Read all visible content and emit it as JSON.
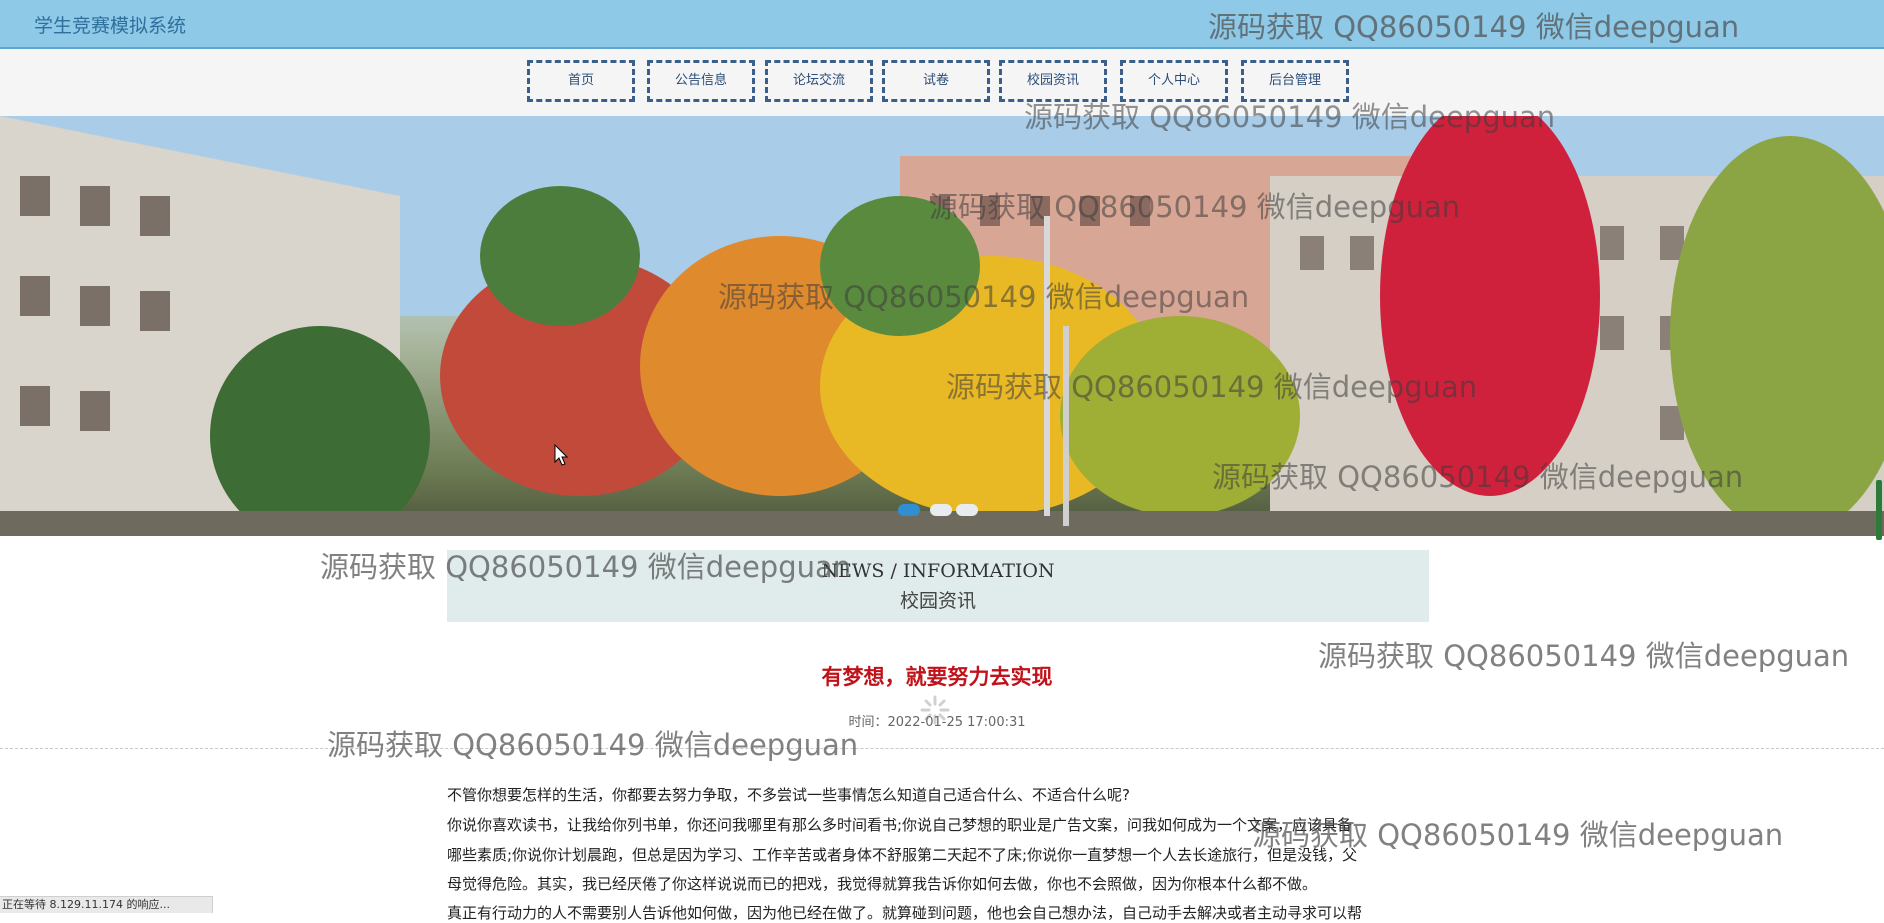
{
  "header": {
    "site_title": "学生竞赛模拟系统"
  },
  "nav": {
    "items": [
      {
        "label": "首页"
      },
      {
        "label": "公告信息"
      },
      {
        "label": "论坛交流"
      },
      {
        "label": "试卷"
      },
      {
        "label": "校园资讯"
      },
      {
        "label": "个人中心"
      },
      {
        "label": "后台管理"
      }
    ]
  },
  "banner": {
    "slides_count": 3,
    "active_slide": 1
  },
  "news_section": {
    "heading_en": "NEWS / INFORMATION",
    "heading_cn": "校园资讯"
  },
  "article": {
    "title": "有梦想，就要努力去实现",
    "time_text": "时间：2022-01-25 17:00:31",
    "paragraph_lines": [
      "不管你想要怎样的生活，你都要去努力争取，不多尝试一些事情怎么知道自己适合什么、不适合什么呢?",
      "你说你喜欢读书，让我给你列书单，你还问我哪里有那么多时间看书;你说自己梦想的职业是广告文案，问我如何成为一个文案，应该具备",
      "哪些素质;你说你计划晨跑，但总是因为学习、工作辛苦或者身体不舒服第二天起不了床;你说你一直梦想一个人去长途旅行，但是没钱，父",
      "母觉得危险。其实，我已经厌倦了你这样说说而已的把戏，我觉得就算我告诉你如何去做，你也不会照做，因为你根本什么都不做。",
      "真正有行动力的人不需要别人告诉他如何做，因为他已经在做了。就算碰到问题，他也会自己想办法，自己动手去解决或者主动寻求可以帮"
    ]
  },
  "status_bar": {
    "text": "正在等待 8.129.11.174 的响应..."
  },
  "watermark": {
    "text": "源码获取 QQ86050149 微信deepguan"
  },
  "colors": {
    "topbar": "#8ec9e8",
    "nav_border": "#3a5f8a",
    "news_head_bg": "#e0ecec",
    "article_title": "#c0121a"
  }
}
